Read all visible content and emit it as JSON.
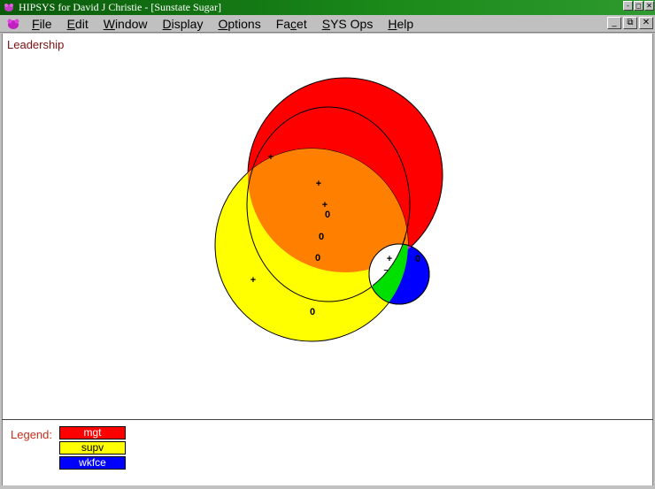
{
  "window": {
    "title": "HIPSYS for David J Christie - [Sunstate Sugar]",
    "controls": {
      "minimize": "-",
      "restore": "◻",
      "close": "✕"
    }
  },
  "menu": {
    "items": [
      {
        "label": "File",
        "accel": "F",
        "rest": "ile"
      },
      {
        "label": "Edit",
        "accel": "E",
        "rest": "dit"
      },
      {
        "label": "Window",
        "accel": "W",
        "rest": "indow"
      },
      {
        "label": "Display",
        "accel": "D",
        "rest": "isplay"
      },
      {
        "label": "Options",
        "accel": "O",
        "rest": "ptions"
      },
      {
        "label": "Facet",
        "pre": "Fa",
        "accel": "c",
        "post": "et"
      },
      {
        "label": "SYS Ops",
        "accel": "S",
        "rest": "YS Ops"
      },
      {
        "label": "Help",
        "accel": "H",
        "rest": "elp"
      }
    ],
    "mdi_controls": {
      "minimize": "_",
      "restore": "⧉",
      "close": "✕"
    }
  },
  "facet": {
    "title": "Leadership"
  },
  "diagram": {
    "marks": [
      "+",
      "+",
      "+",
      "0",
      "0",
      "0",
      "+",
      "0",
      "+",
      "–",
      "0"
    ],
    "colors": {
      "mgt": "#ff0000",
      "supv": "#ffff00",
      "wkfce": "#0000ff",
      "mgt_supv": "#ff8000",
      "mgt_wkfce": "#ff00ff",
      "supv_wkfce": "#00e000",
      "all_three": "#ffffff"
    }
  },
  "legend": {
    "label": "Legend:",
    "items": [
      {
        "name": "mgt",
        "color": "#ff0000",
        "text_color": "#ffffff"
      },
      {
        "name": "supv",
        "color": "#ffff00",
        "text_color": "#000000"
      },
      {
        "name": "wkfce",
        "color": "#0000ff",
        "text_color": "#ffffff"
      }
    ]
  }
}
